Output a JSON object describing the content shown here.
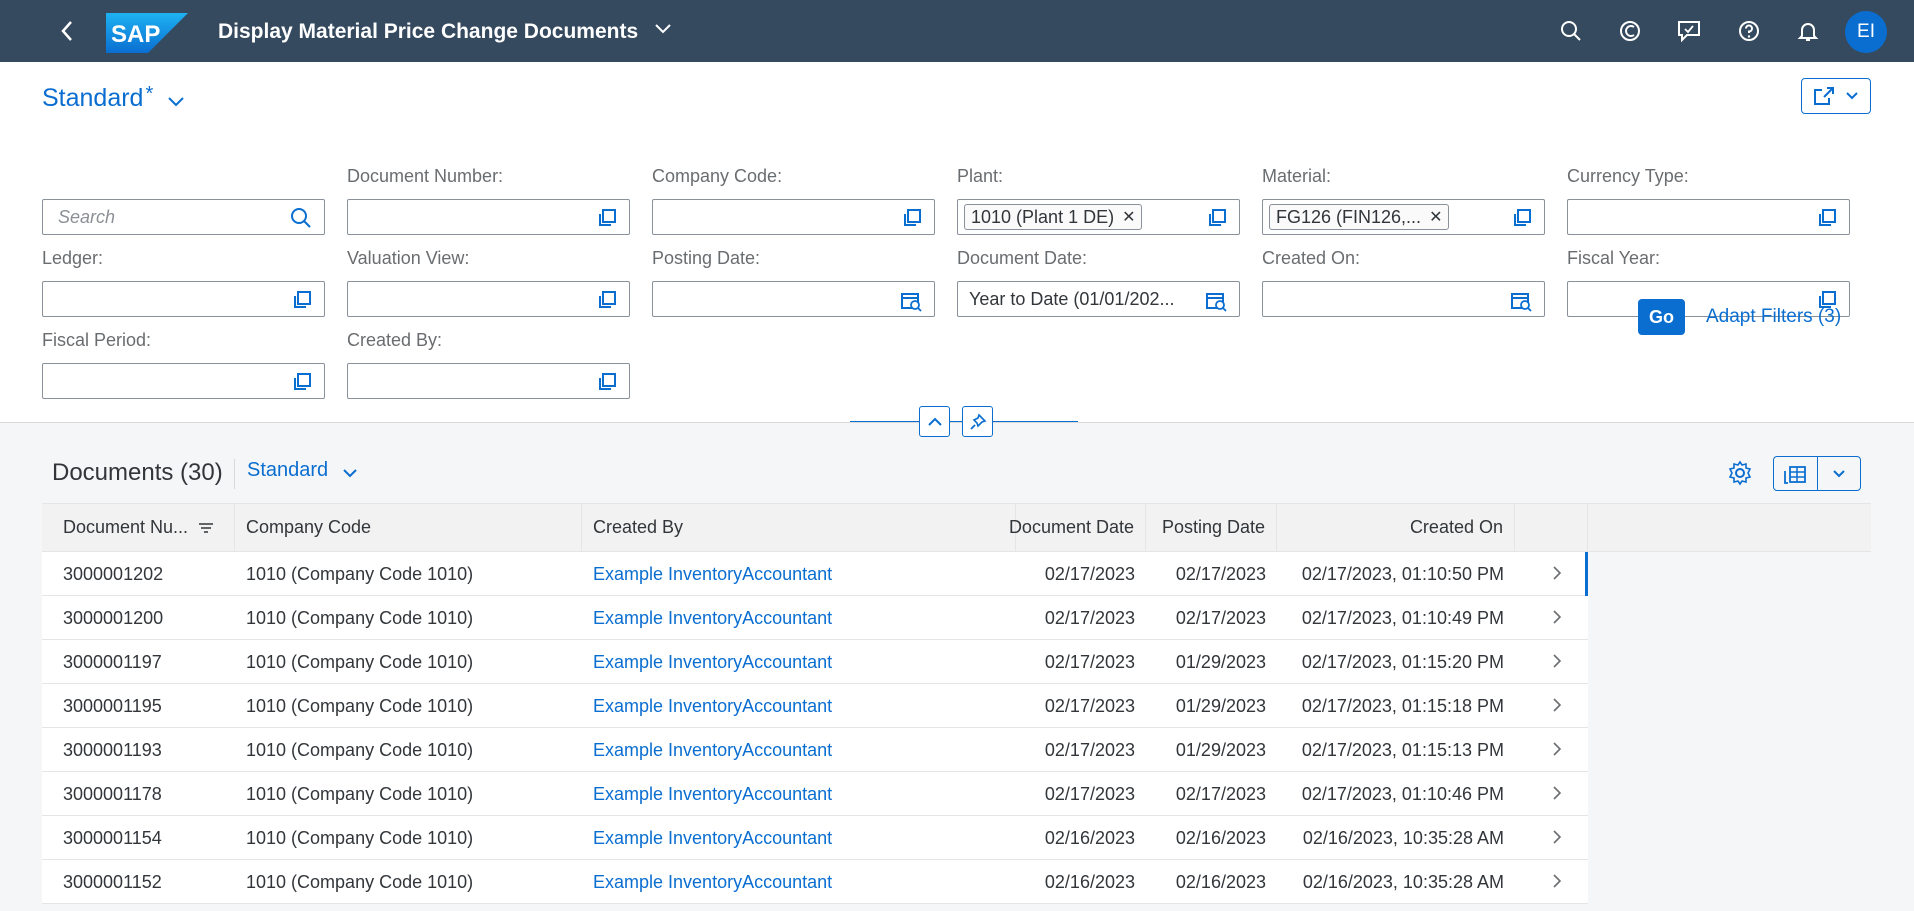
{
  "shell": {
    "logo_text": "SAP",
    "title": "Display Material Price Change Documents",
    "avatar_initials": "EI",
    "brand_color": "#354a5f",
    "accent_color": "#0a6ed1",
    "icons": [
      "back-icon",
      "search-icon",
      "joule-icon",
      "feedback-icon",
      "help-icon",
      "notifications-icon"
    ]
  },
  "filter_bar": {
    "variant_name": "Standard",
    "variant_modified": "*",
    "search_placeholder": "Search",
    "fields": {
      "document_number": {
        "label": "Document Number:",
        "value": ""
      },
      "company_code": {
        "label": "Company Code:",
        "value": ""
      },
      "plant": {
        "label": "Plant:",
        "token": "1010 (Plant 1 DE)"
      },
      "material": {
        "label": "Material:",
        "token": "FG126 (FIN126,..."
      },
      "currency_type": {
        "label": "Currency Type:",
        "value": ""
      },
      "ledger": {
        "label": "Ledger:",
        "value": ""
      },
      "valuation_view": {
        "label": "Valuation View:",
        "value": ""
      },
      "posting_date": {
        "label": "Posting Date:",
        "value": ""
      },
      "document_date": {
        "label": "Document Date:",
        "value": "Year to Date (01/01/202..."
      },
      "created_on": {
        "label": "Created On:",
        "value": ""
      },
      "fiscal_year": {
        "label": "Fiscal Year:",
        "value": ""
      },
      "fiscal_period": {
        "label": "Fiscal Period:",
        "value": ""
      },
      "created_by": {
        "label": "Created By:",
        "value": ""
      }
    },
    "go_label": "Go",
    "adapt_filters_label": "Adapt Filters (3)"
  },
  "table": {
    "title": "Documents (30)",
    "variant_name": "Standard",
    "columns": [
      "Document Nu...",
      "Company Code",
      "Created By",
      "Document Date",
      "Posting Date",
      "Created On"
    ],
    "rows": [
      {
        "doc": "3000001202",
        "company": "1010 (Company Code 1010)",
        "created_by": "Example InventoryAccountant",
        "doc_date": "02/17/2023",
        "post_date": "02/17/2023",
        "created_on": "02/17/2023, 01:10:50 PM",
        "selected": true
      },
      {
        "doc": "3000001200",
        "company": "1010 (Company Code 1010)",
        "created_by": "Example InventoryAccountant",
        "doc_date": "02/17/2023",
        "post_date": "02/17/2023",
        "created_on": "02/17/2023, 01:10:49 PM"
      },
      {
        "doc": "3000001197",
        "company": "1010 (Company Code 1010)",
        "created_by": "Example InventoryAccountant",
        "doc_date": "02/17/2023",
        "post_date": "01/29/2023",
        "created_on": "02/17/2023, 01:15:20 PM"
      },
      {
        "doc": "3000001195",
        "company": "1010 (Company Code 1010)",
        "created_by": "Example InventoryAccountant",
        "doc_date": "02/17/2023",
        "post_date": "01/29/2023",
        "created_on": "02/17/2023, 01:15:18 PM"
      },
      {
        "doc": "3000001193",
        "company": "1010 (Company Code 1010)",
        "created_by": "Example InventoryAccountant",
        "doc_date": "02/17/2023",
        "post_date": "01/29/2023",
        "created_on": "02/17/2023, 01:15:13 PM"
      },
      {
        "doc": "3000001178",
        "company": "1010 (Company Code 1010)",
        "created_by": "Example InventoryAccountant",
        "doc_date": "02/17/2023",
        "post_date": "02/17/2023",
        "created_on": "02/17/2023, 01:10:46 PM"
      },
      {
        "doc": "3000001154",
        "company": "1010 (Company Code 1010)",
        "created_by": "Example InventoryAccountant",
        "doc_date": "02/16/2023",
        "post_date": "02/16/2023",
        "created_on": "02/16/2023, 10:35:28 AM"
      },
      {
        "doc": "3000001152",
        "company": "1010 (Company Code 1010)",
        "created_by": "Example InventoryAccountant",
        "doc_date": "02/16/2023",
        "post_date": "02/16/2023",
        "created_on": "02/16/2023, 10:35:28 AM"
      }
    ]
  }
}
